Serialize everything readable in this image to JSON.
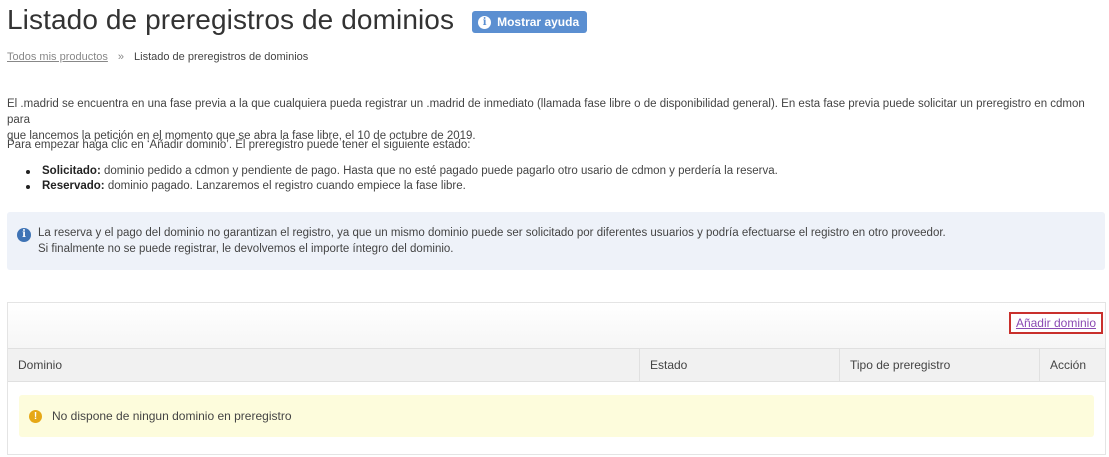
{
  "header": {
    "title": "Listado de preregistros de dominios",
    "help_button": "Mostrar ayuda",
    "help_icon": "info-icon"
  },
  "breadcrumb": {
    "items": [
      "Todos mis productos",
      "Listado de preregistros de dominios"
    ],
    "separator": "»"
  },
  "content": {
    "intro_line1": "El .madrid se encuentra en una fase previa a la que cualquiera pueda registrar un .madrid de inmediato (llamada fase libre o de disponibilidad general). En esta fase previa puede solicitar un preregistro en cdmon para",
    "intro_line2": "que lancemos la petición en el momento que se abra la fase libre, el 10 de octubre de 2019.",
    "instructions": "Para empezar haga clic en ‘Añadir dominio’. El preregistro puede tener el siguiente estado:",
    "states": [
      {
        "label": "Solicitado:",
        "text": " dominio pedido a cdmon y pendiente de pago. Hasta que no esté pagado puede pagarlo otro usario de cdmon y perdería la reserva."
      },
      {
        "label": "Reservado:",
        "text": " dominio pagado. Lanzaremos el registro cuando empiece la fase libre."
      }
    ]
  },
  "info_box": {
    "line1": "La reserva y el pago del dominio no garantizan el registro, ya que un mismo dominio puede ser solicitado por diferentes usuarios y podría efectuarse el registro en otro proveedor.",
    "line2": "Si finalmente no se puede registrar, le devolvemos el importe íntegro del dominio.",
    "icon": "info-icon",
    "color": "#eef2f9"
  },
  "table": {
    "add_link": "Añadir dominio",
    "columns": [
      "Dominio",
      "Estado",
      "Tipo de preregistro",
      "Acción"
    ],
    "empty_message": "No dispone de ningun dominio en preregistro",
    "empty_icon": "warning-icon"
  },
  "colors": {
    "help_button_bg": "#5b8fd1",
    "highlight_border": "#c9302c",
    "warning_bg": "#fdfcdc",
    "warning_icon": "#e6a817"
  }
}
